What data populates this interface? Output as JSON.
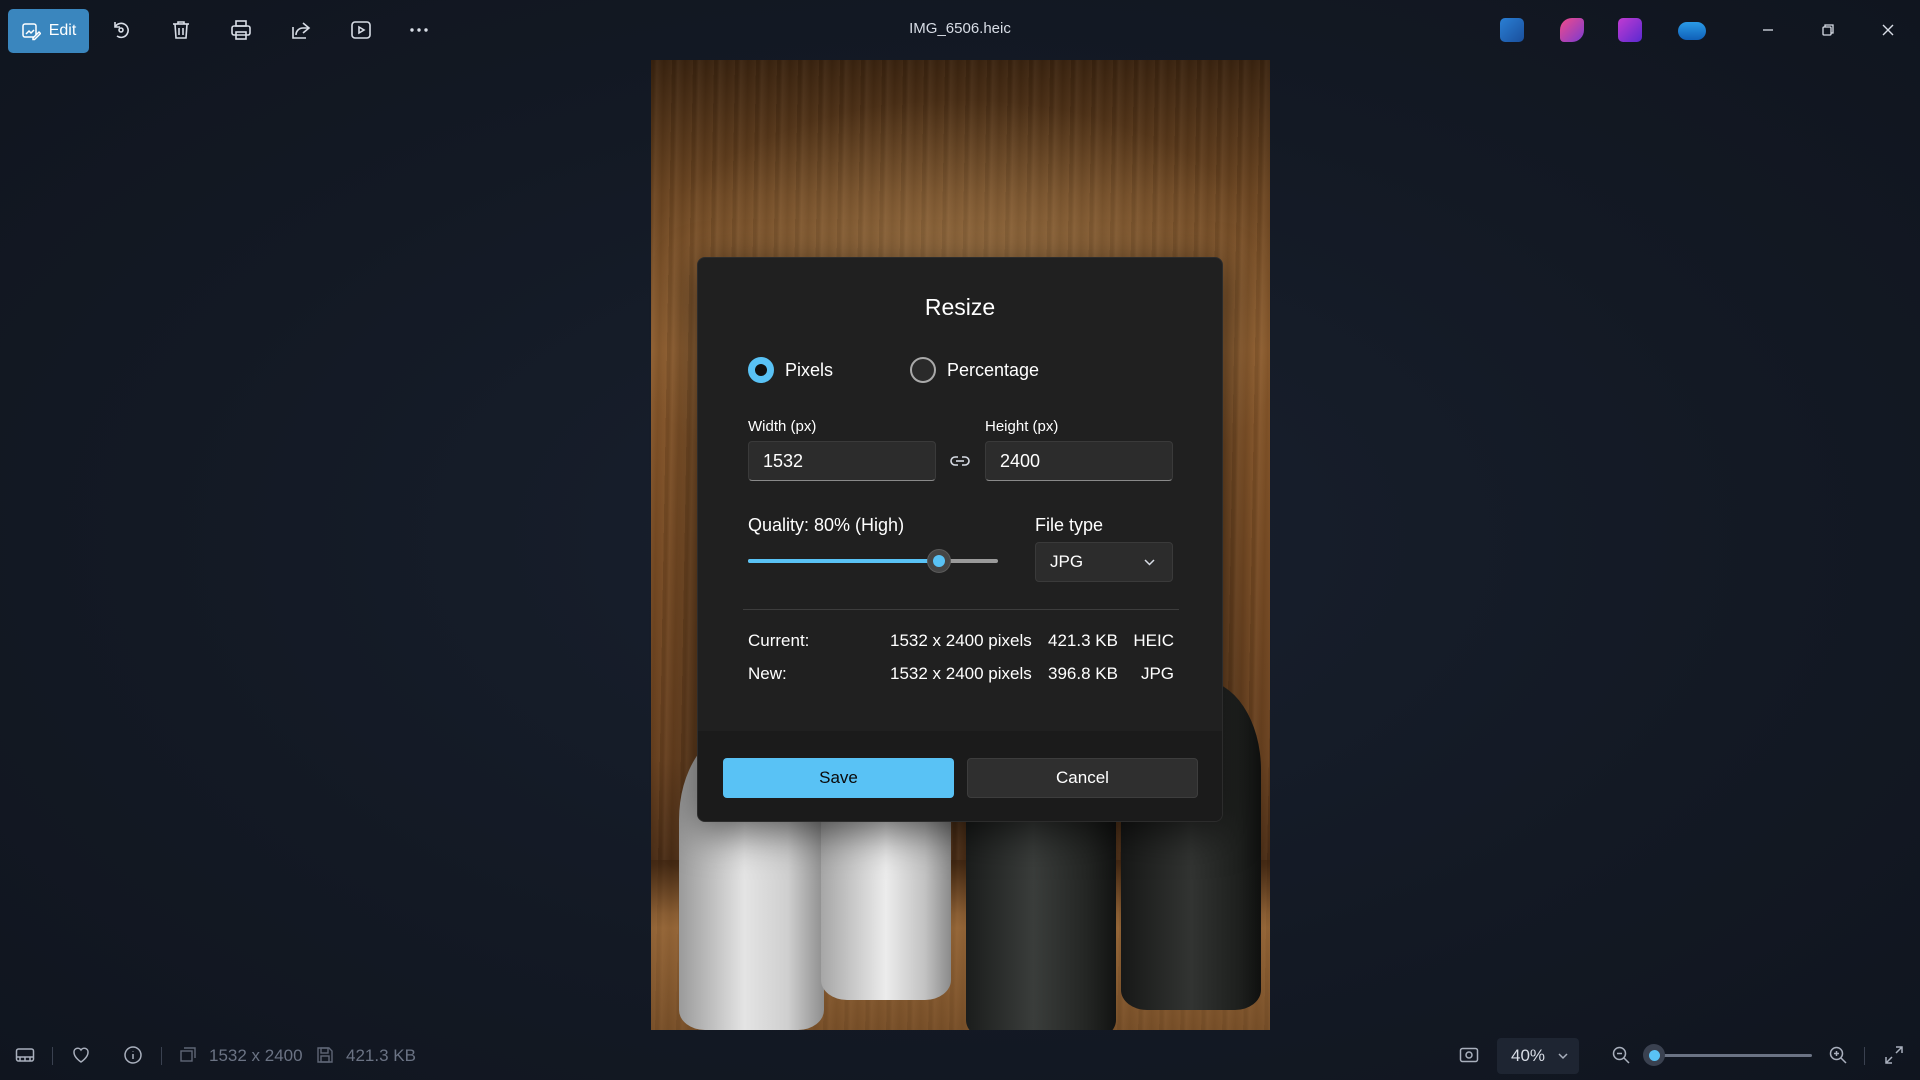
{
  "toolbar": {
    "edit_label": "Edit",
    "icons": [
      "rotate-icon",
      "delete-icon",
      "print-icon",
      "share-icon",
      "slideshow-icon",
      "more-icon"
    ]
  },
  "window": {
    "title": "IMG_6506.heic",
    "apps": [
      "designer-app-icon",
      "clipchamp-app-icon",
      "video-editor-app-icon",
      "onedrive-icon"
    ]
  },
  "dialog": {
    "title": "Resize",
    "mode_options": [
      {
        "label": "Pixels",
        "selected": true
      },
      {
        "label": "Percentage",
        "selected": false
      }
    ],
    "width_label": "Width  (px)",
    "width_value": "1532",
    "height_label": "Height  (px)",
    "height_value": "2400",
    "quality_label": "Quality: 80% (High)",
    "quality_value": 80,
    "filetype_label": "File type",
    "filetype_value": "JPG",
    "current": {
      "label": "Current:",
      "dimensions": "1532 x 2400 pixels",
      "size": "421.3 KB",
      "type": "HEIC"
    },
    "new": {
      "label": "New:",
      "dimensions": "1532 x 2400 pixels",
      "size": "396.8 KB",
      "type": "JPG"
    },
    "save_label": "Save",
    "cancel_label": "Cancel",
    "accent_color": "#59c2f5"
  },
  "statusbar": {
    "dimensions": "1532 x 2400",
    "file_size": "421.3 KB",
    "zoom_label": "40%",
    "zoom_value": 40
  }
}
